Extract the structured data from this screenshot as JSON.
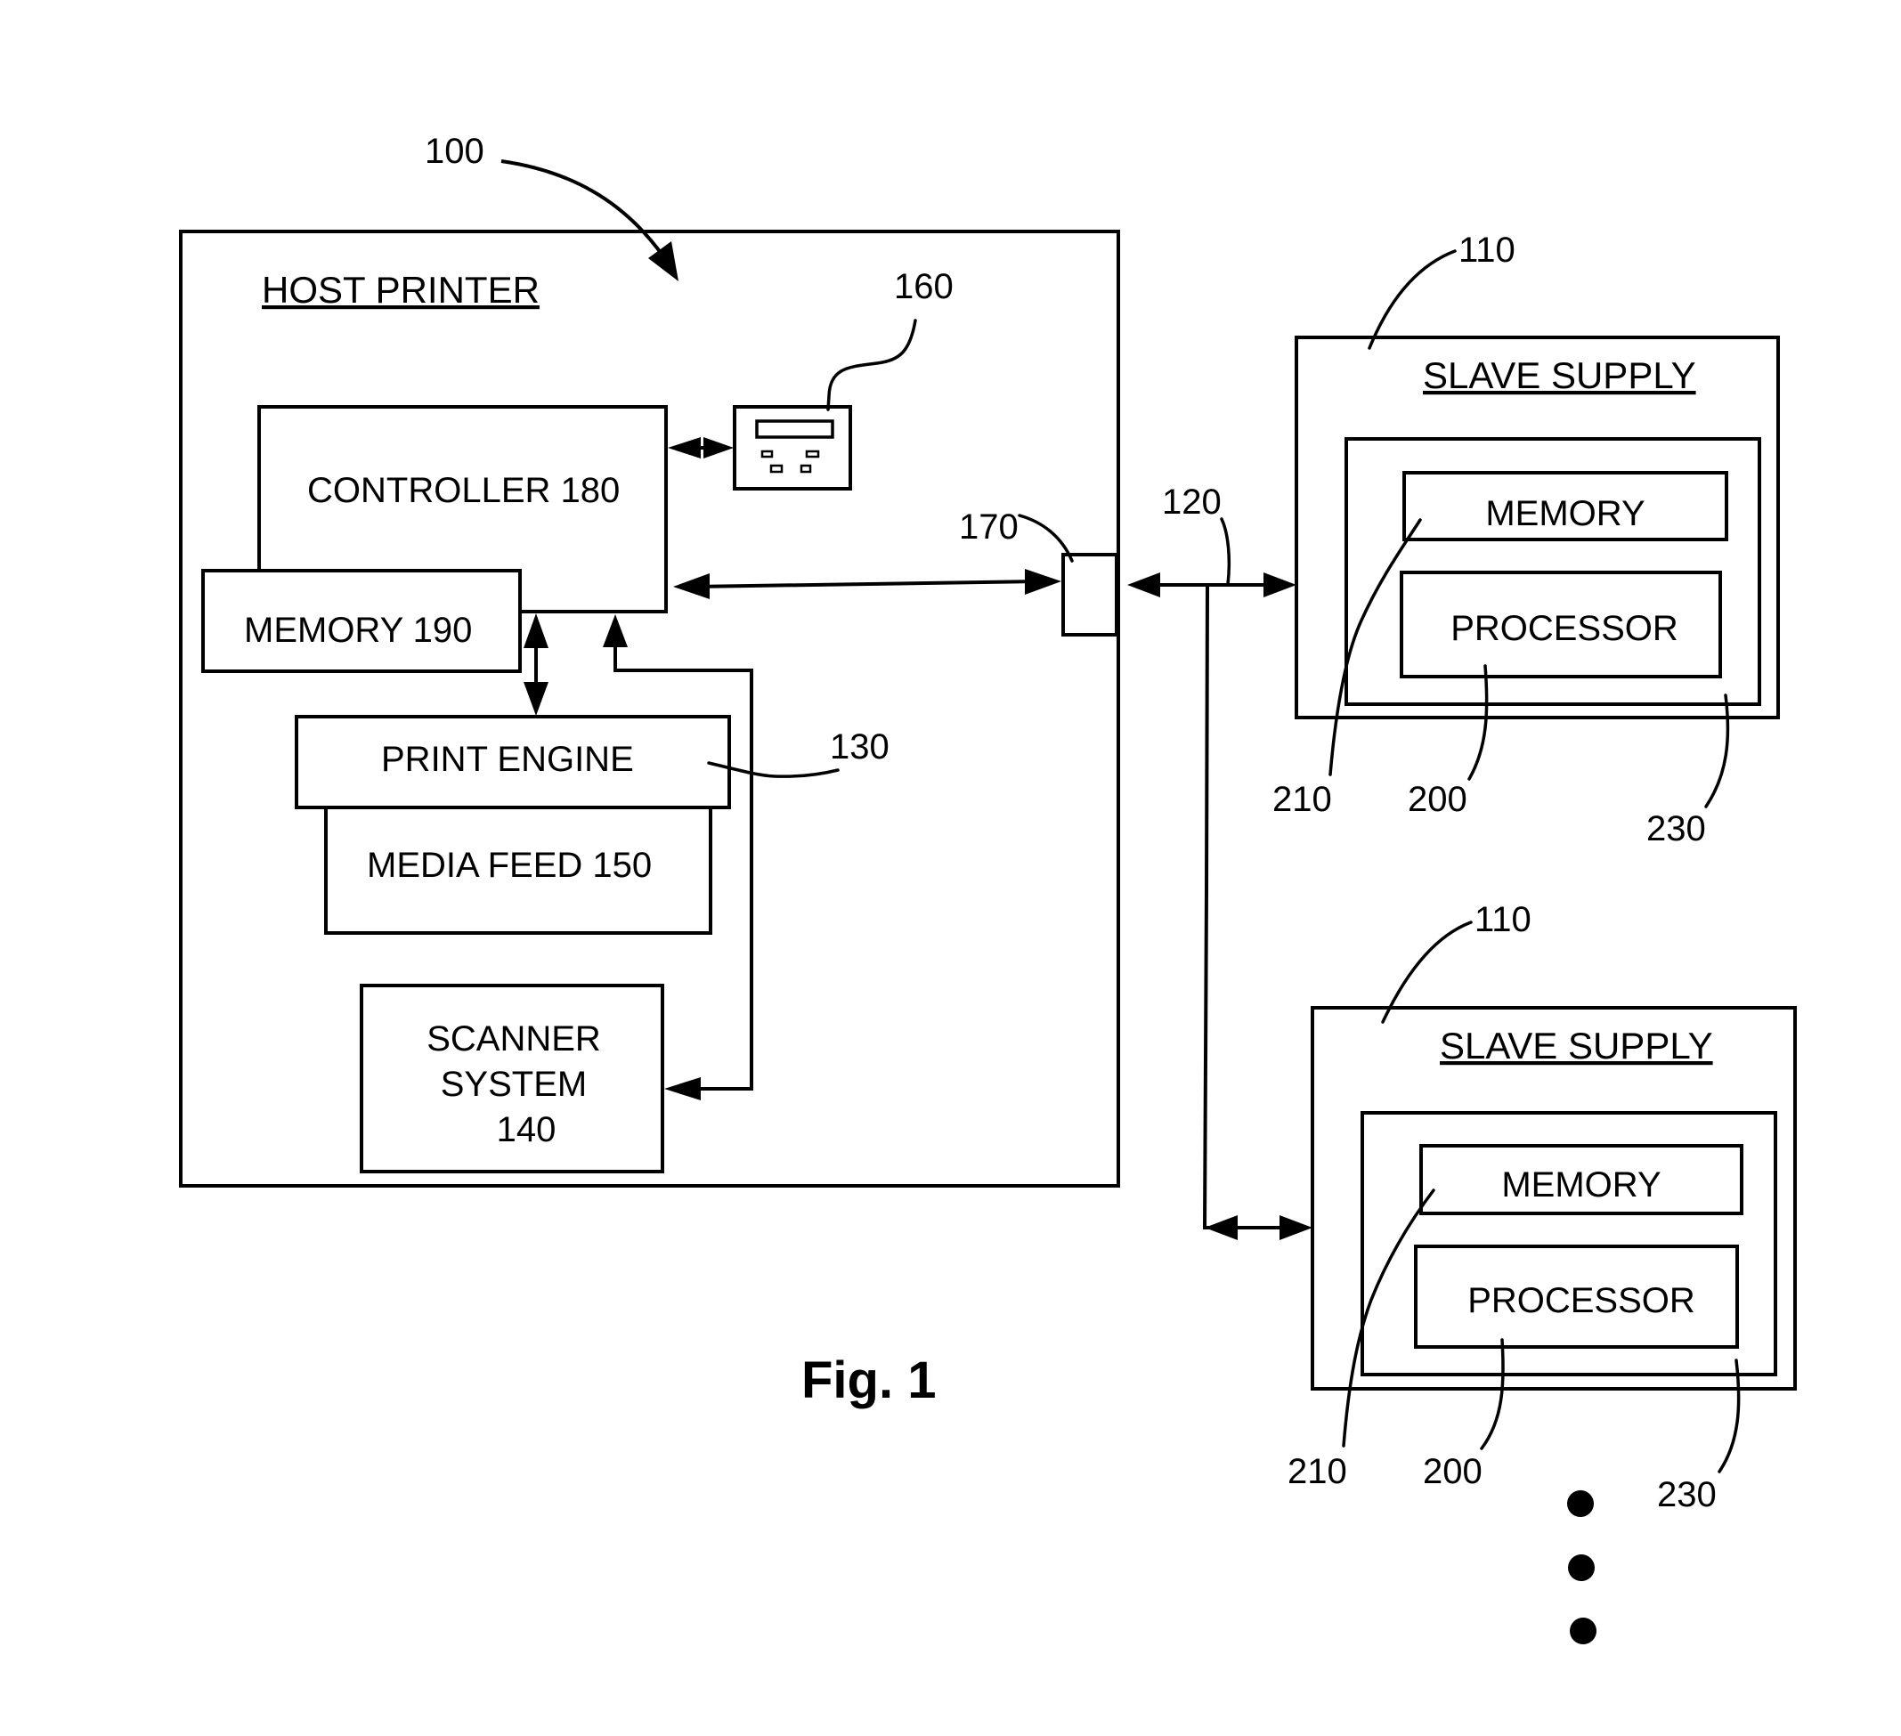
{
  "figure": {
    "caption": "Fig. 1",
    "colors": {
      "ink": "#000000",
      "background": "#ffffff"
    }
  },
  "host": {
    "ref": "100",
    "title": "HOST PRINTER",
    "controller": "CONTROLLER 180",
    "memory": "MEMORY 190",
    "print_engine": "PRINT ENGINE",
    "print_engine_ref": "130",
    "media_feed": "MEDIA FEED 150",
    "scanner": [
      "SCANNER",
      "SYSTEM",
      "140"
    ],
    "user_interface_ref": "160",
    "interface_port_ref": "170"
  },
  "bus": {
    "ref": "120"
  },
  "slaves": [
    {
      "ref": "110",
      "title": "SLAVE SUPPLY",
      "memory": "MEMORY",
      "processor": "PROCESSOR",
      "memory_ref": "210",
      "processor_ref": "200",
      "module_ref": "230"
    },
    {
      "ref": "110",
      "title": "SLAVE SUPPLY",
      "memory": "MEMORY",
      "processor": "PROCESSOR",
      "memory_ref": "210",
      "processor_ref": "200",
      "module_ref": "230"
    }
  ],
  "continuation": {
    "icon": "ellipsis-vertical-dots",
    "count": 3
  }
}
